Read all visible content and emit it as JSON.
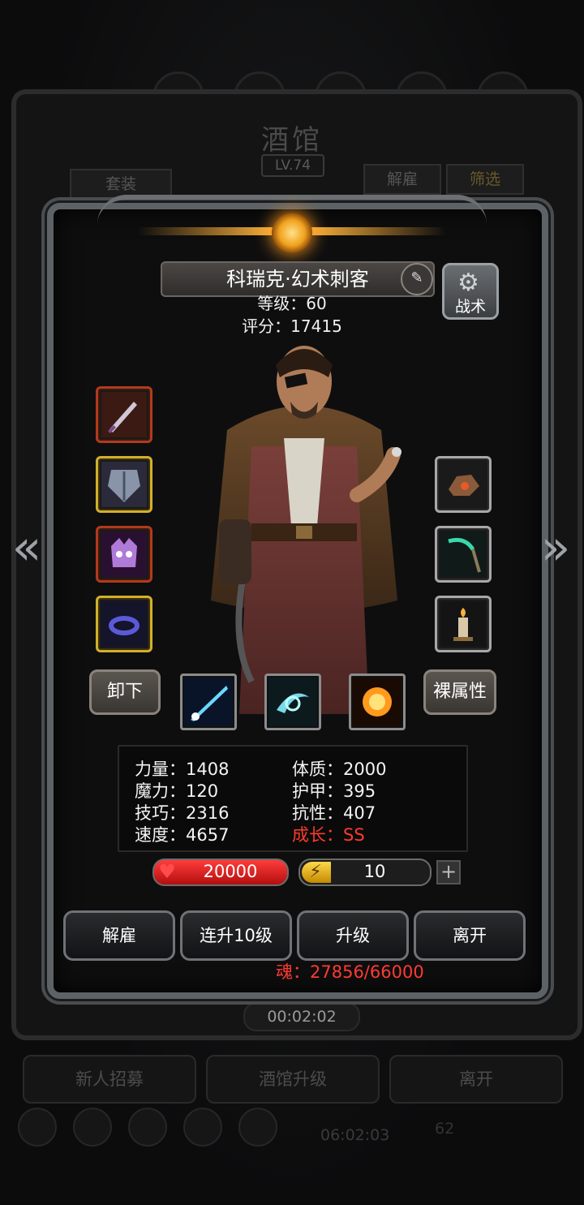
{
  "background": {
    "title": "酒馆",
    "level": "LV.74",
    "btn_set": "套装",
    "btn_dismiss": "解雇",
    "btn_filter": "筛选",
    "timer": "00:02:02",
    "timer2": "06:02:03",
    "count": "62",
    "bottom_buttons": [
      "新人招募",
      "酒馆升级",
      "离开"
    ]
  },
  "hero": {
    "name": "科瑞克·幻术刺客",
    "level_line": "等级：60",
    "score_line": "评分：17415",
    "tactics_label": "战术"
  },
  "equipment": {
    "left": [
      "dagger",
      "armor",
      "demon-helm",
      "ring"
    ],
    "right": [
      "ore",
      "scythe",
      "candle"
    ]
  },
  "buttons": {
    "unequip": "卸下",
    "base_attributes": "裸属性"
  },
  "skills": [
    "light-beam-skill",
    "whirlwind-skill",
    "fireball-skill"
  ],
  "attributes": {
    "strength": "力量：1408",
    "magic": "魔力：120",
    "skill": "技巧：2316",
    "speed": "速度：4657",
    "constitution": "体质：2000",
    "armor": "护甲：395",
    "resistance": "抗性：407",
    "growth": "成长：SS"
  },
  "hp": "20000",
  "energy": "10",
  "energy_plus": "+",
  "actions": [
    "解雇",
    "连升10级",
    "升级",
    "离开"
  ],
  "soul": "魂：27856/66000",
  "colors": {
    "frame": "#5d6266",
    "growth": "#ff3b2a",
    "soul": "#ff3a32",
    "hp": "#d41e1e",
    "energy": "#ffd84a"
  }
}
